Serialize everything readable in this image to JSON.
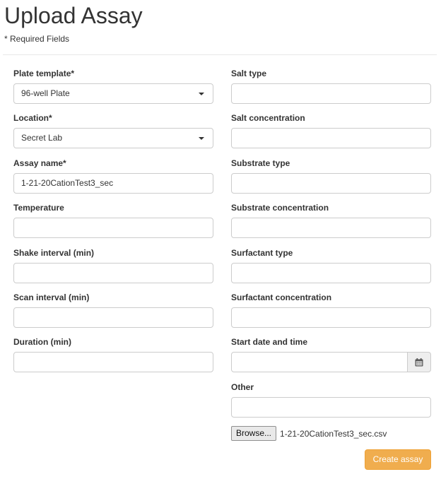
{
  "page": {
    "title": "Upload Assay",
    "required_note": "* Required Fields"
  },
  "form": {
    "left": [
      {
        "label": "Plate template*",
        "type": "select",
        "value": "96-well Plate"
      },
      {
        "label": "Location*",
        "type": "select",
        "value": "Secret Lab"
      },
      {
        "label": "Assay name*",
        "type": "text",
        "value": "1-21-20CationTest3_sec"
      },
      {
        "label": "Temperature",
        "type": "text",
        "value": ""
      },
      {
        "label": "Shake interval (min)",
        "type": "text",
        "value": ""
      },
      {
        "label": "Scan interval (min)",
        "type": "text",
        "value": ""
      },
      {
        "label": "Duration (min)",
        "type": "text",
        "value": ""
      }
    ],
    "right": [
      {
        "label": "Salt type",
        "type": "text",
        "value": ""
      },
      {
        "label": "Salt concentration",
        "type": "text",
        "value": ""
      },
      {
        "label": "Substrate type",
        "type": "text",
        "value": ""
      },
      {
        "label": "Substrate concentration",
        "type": "text",
        "value": ""
      },
      {
        "label": "Surfactant type",
        "type": "text",
        "value": ""
      },
      {
        "label": "Surfactant concentration",
        "type": "text",
        "value": ""
      },
      {
        "label": "Start date and time",
        "type": "date",
        "value": ""
      },
      {
        "label": "Other",
        "type": "text",
        "value": ""
      }
    ],
    "file": {
      "browse_label": "Browse...",
      "filename": "1-21-20CationTest3_sec.csv"
    },
    "submit_label": "Create assay"
  },
  "colors": {
    "submit_bg": "#f0ad4e",
    "border": "#cccccc"
  }
}
